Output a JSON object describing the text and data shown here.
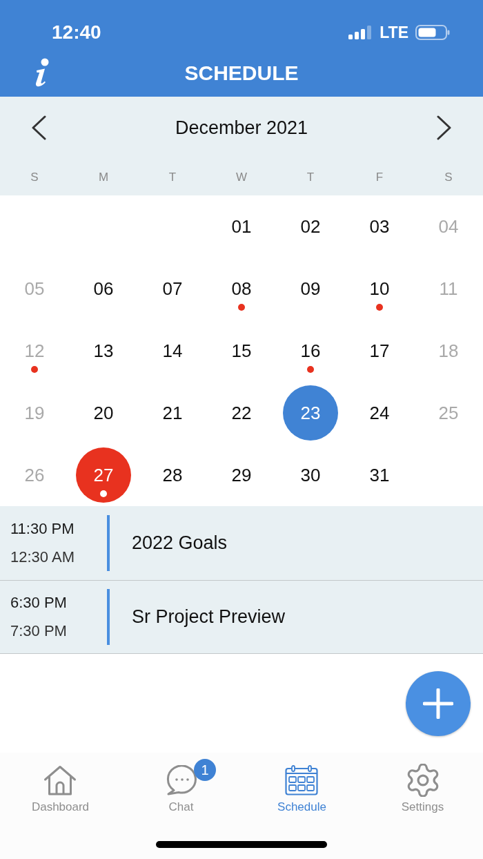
{
  "status_bar": {
    "time": "12:40",
    "network": "LTE"
  },
  "header": {
    "title": "SCHEDULE"
  },
  "calendar": {
    "month": "December 2021",
    "weekdays": [
      "S",
      "M",
      "T",
      "W",
      "T",
      "F",
      "S"
    ],
    "weeks": [
      {
        "days": [
          {
            "kind": "blank"
          },
          {
            "kind": "blank"
          },
          {
            "kind": "blank"
          },
          {
            "kind": "day",
            "label": "01",
            "dimmed": false,
            "event": false,
            "selected": false,
            "today": false
          },
          {
            "kind": "day",
            "label": "02",
            "dimmed": false,
            "event": false,
            "selected": false,
            "today": false
          },
          {
            "kind": "day",
            "label": "03",
            "dimmed": false,
            "event": false,
            "selected": false,
            "today": false
          },
          {
            "kind": "day",
            "label": "04",
            "dimmed": true,
            "event": false,
            "selected": false,
            "today": false
          }
        ]
      },
      {
        "days": [
          {
            "kind": "day",
            "label": "05",
            "dimmed": true,
            "event": false,
            "selected": false,
            "today": false
          },
          {
            "kind": "day",
            "label": "06",
            "dimmed": false,
            "event": false,
            "selected": false,
            "today": false
          },
          {
            "kind": "day",
            "label": "07",
            "dimmed": false,
            "event": false,
            "selected": false,
            "today": false
          },
          {
            "kind": "day",
            "label": "08",
            "dimmed": false,
            "event": true,
            "selected": false,
            "today": false
          },
          {
            "kind": "day",
            "label": "09",
            "dimmed": false,
            "event": false,
            "selected": false,
            "today": false
          },
          {
            "kind": "day",
            "label": "10",
            "dimmed": false,
            "event": true,
            "selected": false,
            "today": false
          },
          {
            "kind": "day",
            "label": "11",
            "dimmed": true,
            "event": false,
            "selected": false,
            "today": false
          }
        ]
      },
      {
        "days": [
          {
            "kind": "day",
            "label": "12",
            "dimmed": true,
            "event": true,
            "selected": false,
            "today": false
          },
          {
            "kind": "day",
            "label": "13",
            "dimmed": false,
            "event": false,
            "selected": false,
            "today": false
          },
          {
            "kind": "day",
            "label": "14",
            "dimmed": false,
            "event": false,
            "selected": false,
            "today": false
          },
          {
            "kind": "day",
            "label": "15",
            "dimmed": false,
            "event": false,
            "selected": false,
            "today": false
          },
          {
            "kind": "day",
            "label": "16",
            "dimmed": false,
            "event": true,
            "selected": false,
            "today": false
          },
          {
            "kind": "day",
            "label": "17",
            "dimmed": false,
            "event": false,
            "selected": false,
            "today": false
          },
          {
            "kind": "day",
            "label": "18",
            "dimmed": true,
            "event": false,
            "selected": false,
            "today": false
          }
        ]
      },
      {
        "days": [
          {
            "kind": "day",
            "label": "19",
            "dimmed": true,
            "event": false,
            "selected": false,
            "today": false
          },
          {
            "kind": "day",
            "label": "20",
            "dimmed": false,
            "event": false,
            "selected": false,
            "today": false
          },
          {
            "kind": "day",
            "label": "21",
            "dimmed": false,
            "event": false,
            "selected": false,
            "today": false
          },
          {
            "kind": "day",
            "label": "22",
            "dimmed": false,
            "event": false,
            "selected": false,
            "today": false
          },
          {
            "kind": "day",
            "label": "23",
            "dimmed": false,
            "event": false,
            "selected": false,
            "today": true
          },
          {
            "kind": "day",
            "label": "24",
            "dimmed": false,
            "event": false,
            "selected": false,
            "today": false
          },
          {
            "kind": "day",
            "label": "25",
            "dimmed": true,
            "event": false,
            "selected": false,
            "today": false
          }
        ]
      },
      {
        "days": [
          {
            "kind": "day",
            "label": "26",
            "dimmed": true,
            "event": false,
            "selected": false,
            "today": false
          },
          {
            "kind": "day",
            "label": "27",
            "dimmed": false,
            "event": true,
            "selected": true,
            "today": false
          },
          {
            "kind": "day",
            "label": "28",
            "dimmed": false,
            "event": false,
            "selected": false,
            "today": false
          },
          {
            "kind": "day",
            "label": "29",
            "dimmed": false,
            "event": false,
            "selected": false,
            "today": false
          },
          {
            "kind": "day",
            "label": "30",
            "dimmed": false,
            "event": false,
            "selected": false,
            "today": false
          },
          {
            "kind": "day",
            "label": "31",
            "dimmed": false,
            "event": false,
            "selected": false,
            "today": false
          },
          {
            "kind": "blank"
          }
        ]
      }
    ]
  },
  "events": [
    {
      "start": "11:30 PM",
      "end": "12:30 AM",
      "title": "2022 Goals"
    },
    {
      "start": "6:30 PM",
      "end": "7:30 PM",
      "title": "Sr Project Preview"
    }
  ],
  "tab_bar": {
    "tabs": [
      {
        "label": "Dashboard",
        "selected": false
      },
      {
        "label": "Chat",
        "selected": false,
        "badge": "1"
      },
      {
        "label": "Schedule",
        "selected": true
      },
      {
        "label": "Settings",
        "selected": false
      }
    ]
  }
}
